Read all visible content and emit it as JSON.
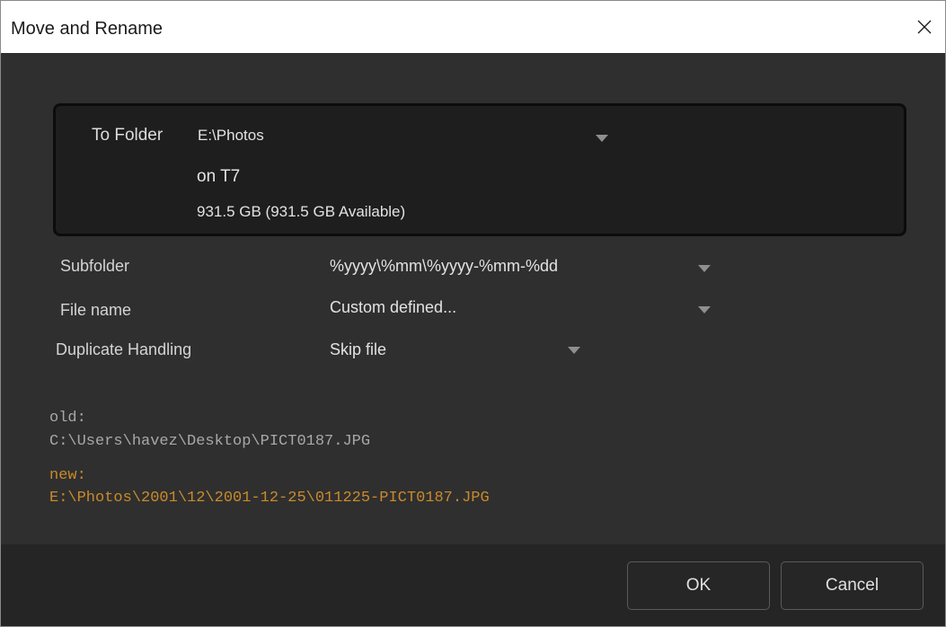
{
  "window": {
    "title": "Move and Rename",
    "close_icon": "close-icon"
  },
  "destination": {
    "to_folder_label": "To Folder",
    "folder_value": "E:\\Photos",
    "drive_name": "on T7",
    "capacity": "931.5 GB (931.5 GB Available)"
  },
  "options": {
    "subfolder_label": "Subfolder",
    "subfolder_value": "%yyyy\\%mm\\%yyyy-%mm-%dd",
    "filename_label": "File name",
    "filename_value": "Custom defined...",
    "duplicate_label": "Duplicate Handling",
    "duplicate_value": "Skip file"
  },
  "preview": {
    "old_label": "old:",
    "old_path": "C:\\Users\\havez\\Desktop\\PICT0187.JPG",
    "new_label": "new:",
    "new_path": "E:\\Photos\\2001\\12\\2001-12-25\\011225-PICT0187.JPG"
  },
  "buttons": {
    "ok": "OK",
    "cancel": "Cancel"
  },
  "colors": {
    "background": "#2f2f2f",
    "panel": "#1e1e1e",
    "footer": "#252525",
    "old_path": "#a8a8a8",
    "new_path": "#c98a2b"
  }
}
